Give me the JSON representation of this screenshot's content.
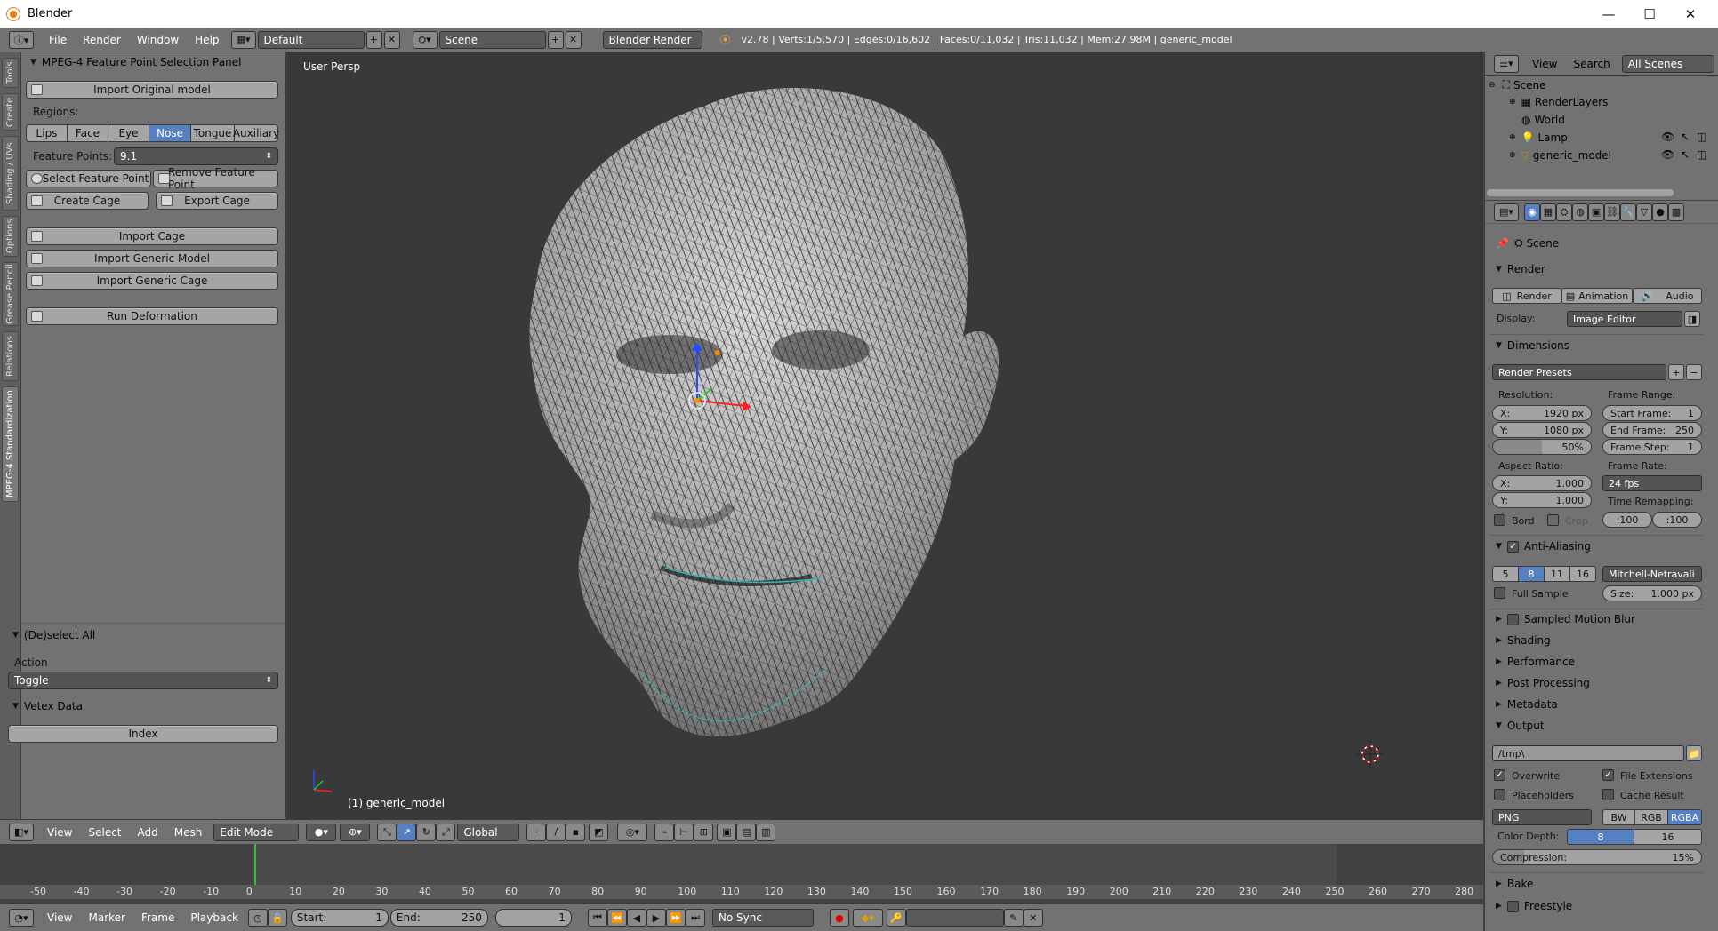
{
  "window": {
    "title": "Blender",
    "minimize": "—",
    "maximize": "☐",
    "close": "✕"
  },
  "info_header": {
    "menus": [
      "File",
      "Render",
      "Window",
      "Help"
    ],
    "layout": "Default",
    "scene": "Scene",
    "engine": "Blender Render",
    "stats": "v2.78 | Verts:1/5,570 | Edges:0/16,602 | Faces:0/11,032 | Tris:11,032 | Mem:27.98M | generic_model"
  },
  "tool_tabs": [
    "Tools",
    "Create",
    "Shading / UVs",
    "Options",
    "Grease Pencil",
    "Relations",
    "MPEG-4 Standardization"
  ],
  "mpeg_panel": {
    "title": "MPEG-4 Feature Point Selection Panel",
    "import_original": "Import Original model",
    "regions_label": "Regions:",
    "regions": [
      "Lips",
      "Face",
      "Eye",
      "Nose",
      "Tongue",
      "Auxiliary"
    ],
    "selected_region": "Nose",
    "feature_points_label": "Feature Points:",
    "feature_points_value": "9.1",
    "select_feature_point": "Select Feature Point",
    "remove_feature_point": "Remove Feature Point",
    "create_cage": "Create Cage",
    "export_cage": "Export Cage",
    "import_cage": "Import Cage",
    "import_generic_model": "Import Generic Model",
    "import_generic_cage": "Import Generic Cage",
    "run_deformation": "Run Deformation"
  },
  "deselect_panel": {
    "title": "(De)select All",
    "action_label": "Action",
    "action_value": "Toggle"
  },
  "vertex_panel": {
    "title": "Vetex Data",
    "index_button": "Index"
  },
  "viewport": {
    "view_label": "User Persp",
    "object_label": "(1) generic_model"
  },
  "view3d_header": {
    "menus": [
      "View",
      "Select",
      "Add",
      "Mesh"
    ],
    "mode": "Edit Mode",
    "orientation": "Global"
  },
  "timeline": {
    "ticks": [
      "-50",
      "-40",
      "-30",
      "-20",
      "-10",
      "0",
      "10",
      "20",
      "30",
      "40",
      "50",
      "60",
      "70",
      "80",
      "90",
      "100",
      "110",
      "120",
      "130",
      "140",
      "150",
      "160",
      "170",
      "180",
      "190",
      "200",
      "210",
      "220",
      "230",
      "240",
      "250",
      "260",
      "270",
      "280"
    ],
    "menus": [
      "View",
      "Marker",
      "Frame",
      "Playback"
    ],
    "start_label": "Start:",
    "start_value": "1",
    "end_label": "End:",
    "end_value": "250",
    "current_frame": "1",
    "sync": "No Sync"
  },
  "outliner": {
    "menus": [
      "View",
      "Search"
    ],
    "filter": "All Scenes",
    "items": [
      "Scene",
      "RenderLayers",
      "World",
      "Lamp",
      "generic_model"
    ]
  },
  "properties": {
    "context": "Scene",
    "render": {
      "title": "Render",
      "buttons": [
        "Render",
        "Animation",
        "Audio"
      ],
      "display_label": "Display:",
      "display_value": "Image Editor"
    },
    "dimensions": {
      "title": "Dimensions",
      "presets": "Render Presets",
      "resolution_label": "Resolution:",
      "res_x_label": "X:",
      "res_x": "1920 px",
      "res_y_label": "Y:",
      "res_y": "1080 px",
      "res_pct": "50%",
      "frame_range_label": "Frame Range:",
      "start_frame_label": "Start Frame:",
      "start_frame": "1",
      "end_frame_label": "End Frame:",
      "end_frame": "250",
      "frame_step_label": "Frame Step:",
      "frame_step": "1",
      "aspect_label": "Aspect Ratio:",
      "aspect_x_label": "X:",
      "aspect_x": "1.000",
      "aspect_y_label": "Y:",
      "aspect_y": "1.000",
      "frame_rate_label": "Frame Rate:",
      "frame_rate": "24 fps",
      "time_remap_label": "Time Remapping:",
      "remap_old": ":100",
      "remap_new": ":100",
      "border": "Bord",
      "crop": "Crop"
    },
    "anti_aliasing": {
      "title": "Anti-Aliasing",
      "samples": [
        "5",
        "8",
        "11",
        "16"
      ],
      "selected": "8",
      "filter": "Mitchell-Netravali",
      "full_sample": "Full Sample",
      "size_label": "Size:",
      "size": "1.000 px"
    },
    "collapsed": [
      "Sampled Motion Blur",
      "Shading",
      "Performance",
      "Post Processing",
      "Metadata"
    ],
    "output": {
      "title": "Output",
      "path": "/tmp\\",
      "overwrite": "Overwrite",
      "file_extensions": "File Extensions",
      "placeholders": "Placeholders",
      "cache_result": "Cache Result",
      "format": "PNG",
      "color_modes": [
        "BW",
        "RGB",
        "RGBA"
      ],
      "color_mode_selected": "RGBA",
      "color_depth_label": "Color Depth:",
      "color_depths": [
        "8",
        "16"
      ],
      "compression_label": "Compression:",
      "compression": "15%"
    },
    "bottom": [
      "Bake",
      "Freestyle"
    ]
  },
  "colors": {
    "selected": "#5680c2",
    "header": "#727272",
    "viewport": "#393939",
    "mesh_wire": "#1a1a1a"
  }
}
